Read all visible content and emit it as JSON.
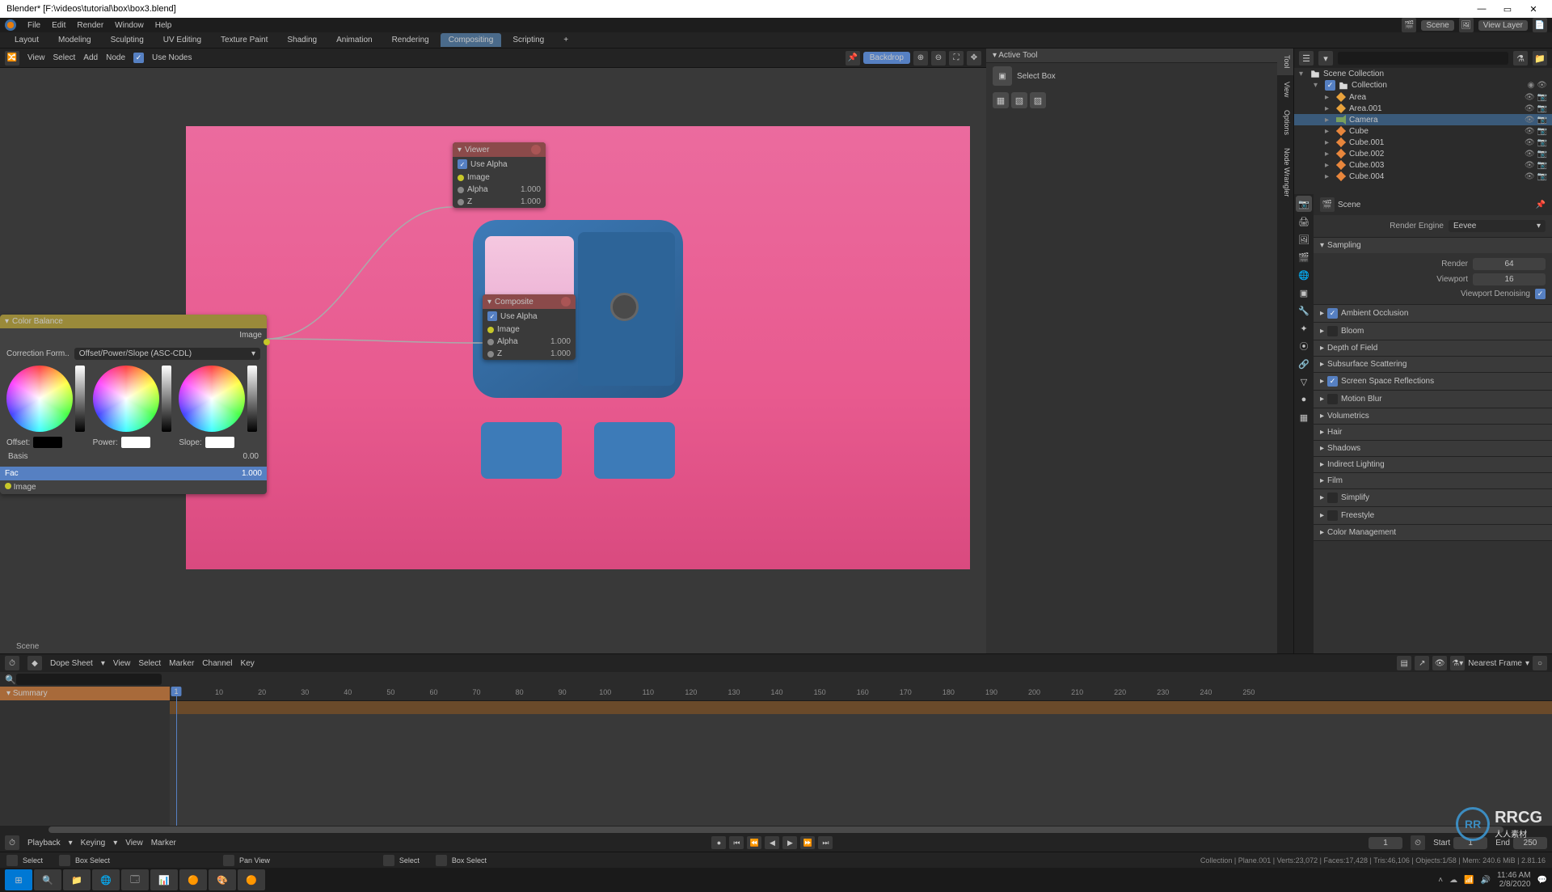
{
  "titlebar": {
    "title": "Blender* [F:\\videos\\tutorial\\box\\box3.blend]"
  },
  "topmenu": {
    "items": [
      "File",
      "Edit",
      "Render",
      "Window",
      "Help"
    ],
    "scene_lbl": "Scene",
    "viewlayer_lbl": "View Layer"
  },
  "workspaces": {
    "tabs": [
      "Layout",
      "Modeling",
      "Sculpting",
      "UV Editing",
      "Texture Paint",
      "Shading",
      "Animation",
      "Rendering",
      "Compositing",
      "Scripting"
    ],
    "active": "Compositing",
    "add": "+"
  },
  "compositor": {
    "menus": [
      "View",
      "Select",
      "Add",
      "Node"
    ],
    "use_nodes_lbl": "Use Nodes",
    "backdrop_lbl": "Backdrop",
    "scene_lbl": "Scene"
  },
  "viewer_node": {
    "title": "Viewer",
    "use_alpha": "Use Alpha",
    "image": "Image",
    "alpha_lbl": "Alpha",
    "alpha_val": "1.000",
    "z_lbl": "Z",
    "z_val": "1.000"
  },
  "composite_node": {
    "title": "Composite",
    "use_alpha": "Use Alpha",
    "image": "Image",
    "alpha_lbl": "Alpha",
    "alpha_val": "1.000",
    "z_lbl": "Z",
    "z_val": "1.000"
  },
  "cb_node": {
    "title": "Color Balance",
    "image_out": "Image",
    "form_lbl": "Correction Form..",
    "form_val": "Offset/Power/Slope (ASC-CDL)",
    "offset": "Offset:",
    "power": "Power:",
    "slope": "Slope:",
    "basis_lbl": "Basis",
    "basis_val": "0.00",
    "fac_lbl": "Fac",
    "fac_val": "1.000",
    "image_in": "Image"
  },
  "tool": {
    "hdr": "Active Tool",
    "name": "Select Box"
  },
  "vtabs": [
    "Tool",
    "View",
    "Options",
    "Node Wrangler"
  ],
  "outliner": {
    "scene_coll": "Scene Collection",
    "collection": "Collection",
    "items": [
      {
        "name": "Area",
        "type": "light"
      },
      {
        "name": "Area.001",
        "type": "light"
      },
      {
        "name": "Camera",
        "type": "cam"
      },
      {
        "name": "Cube",
        "type": "mesh"
      },
      {
        "name": "Cube.001",
        "type": "mesh"
      },
      {
        "name": "Cube.002",
        "type": "mesh"
      },
      {
        "name": "Cube.003",
        "type": "mesh"
      },
      {
        "name": "Cube.004",
        "type": "mesh"
      }
    ]
  },
  "props": {
    "crumb": "Scene",
    "engine_lbl": "Render Engine",
    "engine_val": "Eevee",
    "sampling": "Sampling",
    "render_lbl": "Render",
    "render_val": "64",
    "viewport_lbl": "Viewport",
    "viewport_val": "16",
    "denoise_lbl": "Viewport Denoising",
    "sections": [
      "Ambient Occlusion",
      "Bloom",
      "Depth of Field",
      "Subsurface Scattering",
      "Screen Space Reflections",
      "Motion Blur",
      "Volumetrics",
      "Hair",
      "Shadows",
      "Indirect Lighting",
      "Film",
      "Simplify",
      "Freestyle",
      "Color Management"
    ],
    "checked": {
      "Ambient Occlusion": true,
      "Screen Space Reflections": true
    }
  },
  "dope": {
    "mode": "Dope Sheet",
    "menus": [
      "View",
      "Select",
      "Marker",
      "Channel",
      "Key"
    ],
    "filter": "Nearest Frame",
    "summary": "Summary",
    "ticks": [
      0,
      10,
      20,
      30,
      40,
      50,
      60,
      70,
      80,
      90,
      100,
      110,
      120,
      130,
      140,
      150,
      160,
      170,
      180,
      190,
      200,
      210,
      220,
      230,
      240,
      250
    ],
    "cur": "1"
  },
  "tlfoot": {
    "menus": [
      "Playback",
      "Keying",
      "View",
      "Marker"
    ],
    "cur": "1",
    "start_lbl": "Start",
    "start": "1",
    "end_lbl": "End",
    "end": "250"
  },
  "status": {
    "left": [
      "Select",
      "Box Select",
      "Pan View",
      "Select",
      "Box Select"
    ],
    "right": "Collection | Plane.001 | Verts:23,072 | Faces:17,428 | Tris:46,106 | Objects:1/58 | Mem: 240.6 MiB | 2.81.16"
  },
  "tray": {
    "time": "11:46 AM",
    "date": "2/8/2020"
  },
  "wm": {
    "brand": "RRCG",
    "sub": "人人素材"
  }
}
